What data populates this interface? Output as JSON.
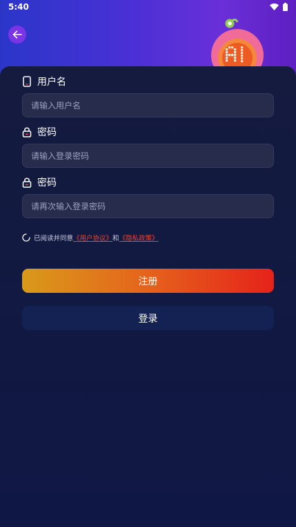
{
  "status_bar": {
    "time": "5:40"
  },
  "form": {
    "username_label": "用户名",
    "username_placeholder": "请输入用户名",
    "password_label": "密码",
    "password_placeholder": "请输入登录密码",
    "confirm_label": "密码",
    "confirm_placeholder": "请再次输入登录密码"
  },
  "agreement": {
    "prefix": "已阅读并同意",
    "user_agreement": "《用户协议》",
    "and": "和",
    "privacy_policy": "《隐私政策》"
  },
  "buttons": {
    "register": "注册",
    "login": "登录"
  },
  "colors": {
    "accent_purple": "#7b35e6",
    "register_gradient_start": "#d99a1a",
    "register_gradient_end": "#e5221a",
    "link_red": "#ee4433",
    "background": "#0f1744"
  },
  "icons": {
    "back": "arrow-left-icon",
    "username": "phone-icon",
    "password": "lock-icon",
    "agreement": "loading-circle-icon",
    "wifi": "wifi-icon",
    "battery": "battery-icon"
  }
}
